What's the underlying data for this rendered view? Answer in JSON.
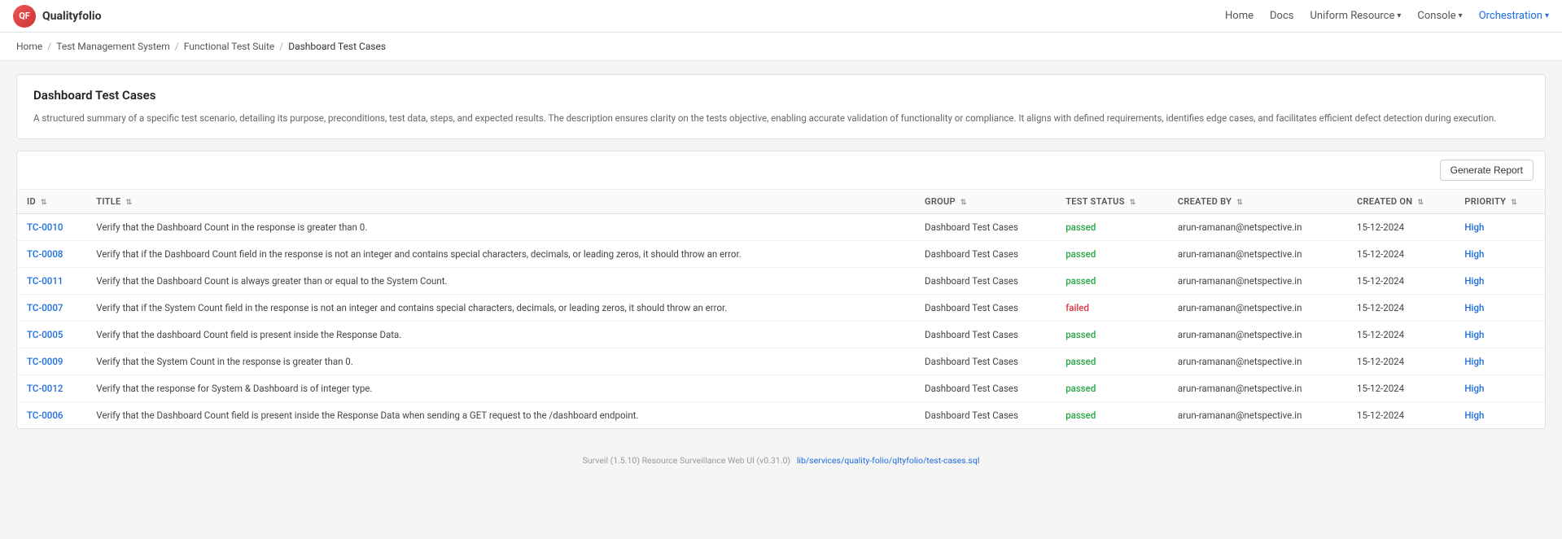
{
  "brand": {
    "logo_text": "QF",
    "name": "Qualityfolio"
  },
  "navbar": {
    "items": [
      {
        "label": "Home",
        "key": "home",
        "dropdown": false,
        "active": false
      },
      {
        "label": "Docs",
        "key": "docs",
        "dropdown": false,
        "active": false
      },
      {
        "label": "Uniform Resource",
        "key": "uniform-resource",
        "dropdown": true,
        "active": false
      },
      {
        "label": "Console",
        "key": "console",
        "dropdown": true,
        "active": false
      },
      {
        "label": "Orchestration",
        "key": "orchestration",
        "dropdown": true,
        "active": true
      }
    ]
  },
  "breadcrumb": {
    "items": [
      {
        "label": "Home",
        "key": "home"
      },
      {
        "label": "Test Management System",
        "key": "tms"
      },
      {
        "label": "Functional Test Suite",
        "key": "fts"
      },
      {
        "label": "Dashboard Test Cases",
        "key": "dtc",
        "current": true
      }
    ]
  },
  "page": {
    "title": "Dashboard Test Cases",
    "description": "A structured summary of a specific test scenario, detailing its purpose, preconditions, test data, steps, and expected results. The description ensures clarity on the tests objective, enabling accurate validation of functionality or compliance. It aligns with defined requirements, identifies edge cases, and facilitates efficient defect detection during execution."
  },
  "toolbar": {
    "generate_report_label": "Generate Report"
  },
  "table": {
    "columns": [
      {
        "label": "ID",
        "key": "id"
      },
      {
        "label": "TITLE",
        "key": "title"
      },
      {
        "label": "GROUP",
        "key": "group"
      },
      {
        "label": "TEST STATUS",
        "key": "test_status"
      },
      {
        "label": "CREATED BY",
        "key": "created_by"
      },
      {
        "label": "CREATED ON",
        "key": "created_on"
      },
      {
        "label": "PRIORITY",
        "key": "priority"
      }
    ],
    "rows": [
      {
        "id": "TC-0010",
        "title": "Verify that the Dashboard Count in the response is greater than 0.",
        "group": "Dashboard Test Cases",
        "test_status": "passed",
        "created_by": "arun-ramanan@netspective.in",
        "created_on": "15-12-2024",
        "priority": "High"
      },
      {
        "id": "TC-0008",
        "title": "Verify that if the Dashboard Count field in the response is not an integer and contains special characters, decimals, or leading zeros, it should throw an error.",
        "group": "Dashboard Test Cases",
        "test_status": "passed",
        "created_by": "arun-ramanan@netspective.in",
        "created_on": "15-12-2024",
        "priority": "High"
      },
      {
        "id": "TC-0011",
        "title": "Verify that the Dashboard Count is always greater than or equal to the System Count.",
        "group": "Dashboard Test Cases",
        "test_status": "passed",
        "created_by": "arun-ramanan@netspective.in",
        "created_on": "15-12-2024",
        "priority": "High"
      },
      {
        "id": "TC-0007",
        "title": "Verify that if the System Count field in the response is not an integer and contains special characters, decimals, or leading zeros, it should throw an error.",
        "group": "Dashboard Test Cases",
        "test_status": "failed",
        "created_by": "arun-ramanan@netspective.in",
        "created_on": "15-12-2024",
        "priority": "High"
      },
      {
        "id": "TC-0005",
        "title": "Verify that the dashboard Count field is present inside the Response Data.",
        "group": "Dashboard Test Cases",
        "test_status": "passed",
        "created_by": "arun-ramanan@netspective.in",
        "created_on": "15-12-2024",
        "priority": "High"
      },
      {
        "id": "TC-0009",
        "title": "Verify that the System Count in the response is greater than 0.",
        "group": "Dashboard Test Cases",
        "test_status": "passed",
        "created_by": "arun-ramanan@netspective.in",
        "created_on": "15-12-2024",
        "priority": "High"
      },
      {
        "id": "TC-0012",
        "title": "Verify that the response for System & Dashboard is of integer type.",
        "group": "Dashboard Test Cases",
        "test_status": "passed",
        "created_by": "arun-ramanan@netspective.in",
        "created_on": "15-12-2024",
        "priority": "High"
      },
      {
        "id": "TC-0006",
        "title": "Verify that the Dashboard Count field is present inside the Response Data when sending a GET request to the /dashboard endpoint.",
        "group": "Dashboard Test Cases",
        "test_status": "passed",
        "created_by": "arun-ramanan@netspective.in",
        "created_on": "15-12-2024",
        "priority": "High"
      }
    ]
  },
  "footer": {
    "text": "Surveil (1.5.10) Resource Surveillance Web UI (v0.31.0)",
    "link_label": "lib/services/quality-folio/qltyfolio/test-cases.sql",
    "link_url": "#"
  }
}
